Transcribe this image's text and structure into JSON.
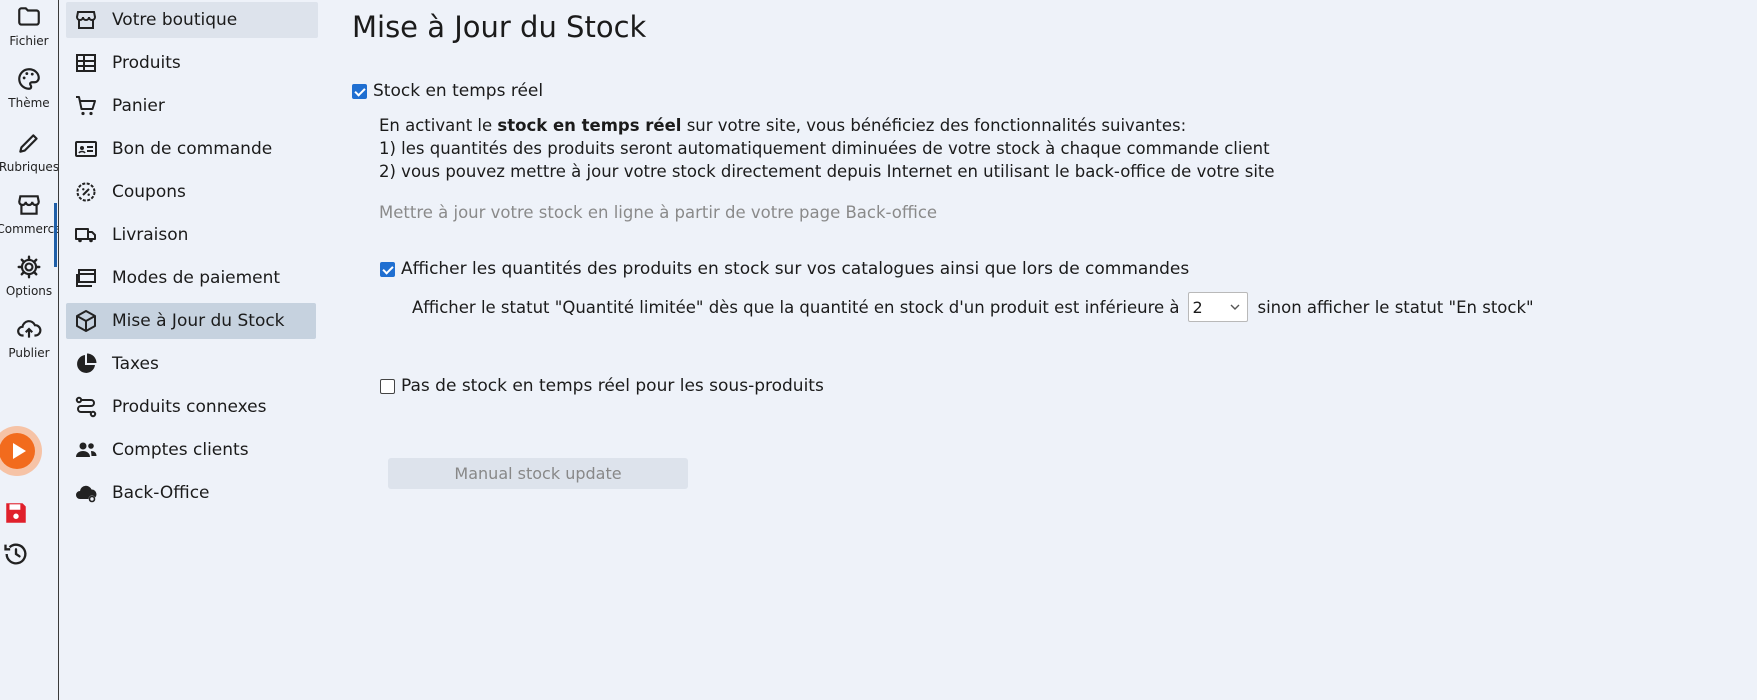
{
  "rail": {
    "items": [
      {
        "label": "Fichier",
        "icon": "folder-icon"
      },
      {
        "label": "Thème",
        "icon": "palette-icon"
      },
      {
        "label": "Rubriques",
        "icon": "pencil-icon"
      },
      {
        "label": "Commerce",
        "icon": "store-icon"
      },
      {
        "label": "Options",
        "icon": "gear-icon"
      },
      {
        "label": "Publier",
        "icon": "cloud-upload-icon"
      }
    ],
    "play_icon": "play-icon",
    "save_icon": "save-icon",
    "history_icon": "history-icon",
    "accent_color": "#f26b1d",
    "save_color": "#e0202b"
  },
  "nav": {
    "items": [
      {
        "label": "Votre boutique",
        "icon": "storefront-icon"
      },
      {
        "label": "Produits",
        "icon": "table-icon"
      },
      {
        "label": "Panier",
        "icon": "cart-icon"
      },
      {
        "label": "Bon de commande",
        "icon": "id-card-icon"
      },
      {
        "label": "Coupons",
        "icon": "coupon-icon"
      },
      {
        "label": "Livraison",
        "icon": "truck-icon"
      },
      {
        "label": "Modes de paiement",
        "icon": "payment-icon"
      },
      {
        "label": "Mise à Jour du Stock",
        "icon": "box-icon"
      },
      {
        "label": "Taxes",
        "icon": "pie-chart-icon"
      },
      {
        "label": "Produits connexes",
        "icon": "route-icon"
      },
      {
        "label": "Comptes clients",
        "icon": "users-icon"
      },
      {
        "label": "Back-Office",
        "icon": "cloud-gear-icon"
      }
    ],
    "selected": "Mise à Jour du Stock"
  },
  "main": {
    "title": "Mise à Jour du Stock",
    "realtime_label": "Stock en temps réel",
    "realtime_checked": true,
    "intro_before": "En activant le ",
    "intro_bold": "stock en temps réel",
    "intro_after": " sur votre site, vous bénéficiez des fonctionnalités suivantes:",
    "line1": "1) les quantités des produits seront automatiquement diminuées de votre stock à chaque commande client",
    "line2": "2) vous pouvez mettre à jour votre stock directement depuis Internet en utilisant le back-office de votre site",
    "backoffice_link": "Mettre à jour votre stock en ligne à partir de votre page Back-office",
    "show_qty_label": "Afficher les quantités des produits en stock sur vos catalogues ainsi que lors de commandes",
    "show_qty_checked": true,
    "threshold_before": "Afficher le statut \"Quantité limitée\" dès que la quantité en stock d'un produit est inférieure à",
    "threshold_value": "2",
    "threshold_after": "sinon afficher le statut \"En stock\"",
    "subproducts_label": "Pas de stock en temps réel pour les sous-produits",
    "subproducts_checked": false,
    "manual_button": "Manual stock update",
    "checkbox_color": "#1f6fd1"
  }
}
